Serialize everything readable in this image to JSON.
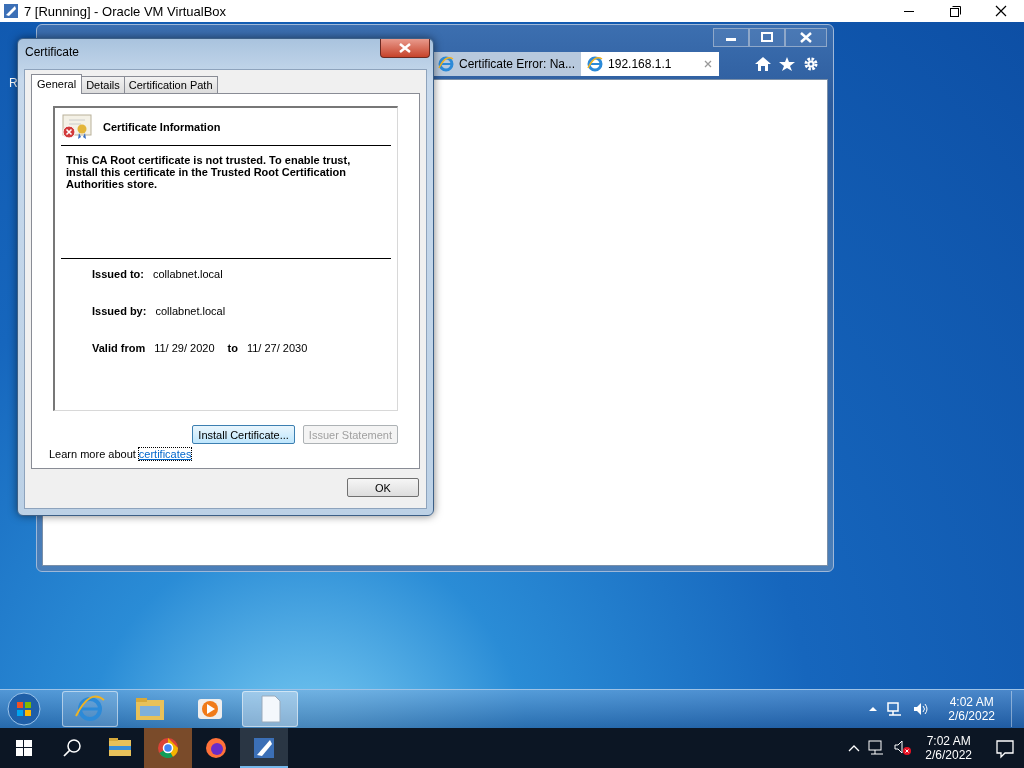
{
  "host_window": {
    "title": "7 [Running] - Oracle VM VirtualBox"
  },
  "desktop_fragment": "R",
  "browser": {
    "tabs": [
      {
        "label": "Certificate Error: Na...",
        "selected": false
      },
      {
        "label": "192.168.1.1",
        "selected": true
      }
    ]
  },
  "dialog": {
    "title": "Certificate",
    "tabs": [
      {
        "label": "General",
        "selected": true
      },
      {
        "label": "Details",
        "selected": false
      },
      {
        "label": "Certification Path",
        "selected": false
      }
    ],
    "heading": "Certificate Information",
    "message": "This CA Root certificate is not trusted. To enable trust, install this certificate in the Trusted Root Certification Authorities store.",
    "fields": [
      {
        "label": "Issued to:",
        "value": "collabnet.local"
      },
      {
        "label": "Issued by:",
        "value": "collabnet.local"
      }
    ],
    "validity": {
      "label": "Valid from",
      "from": "11/ 29/ 2020",
      "to_label": "to",
      "to": "11/ 27/ 2030"
    },
    "buttons": [
      {
        "label": "Install Certificate...",
        "disabled": false
      },
      {
        "label": "Issuer Statement",
        "disabled": true
      }
    ],
    "learn_more": {
      "text": "Learn more about",
      "link": "certificates"
    },
    "ok": "OK"
  },
  "guest_taskbar": {
    "time": "4:02 AM",
    "date": "2/6/2022"
  },
  "host_taskbar": {
    "time": "7:02 AM",
    "date": "2/6/2022"
  }
}
